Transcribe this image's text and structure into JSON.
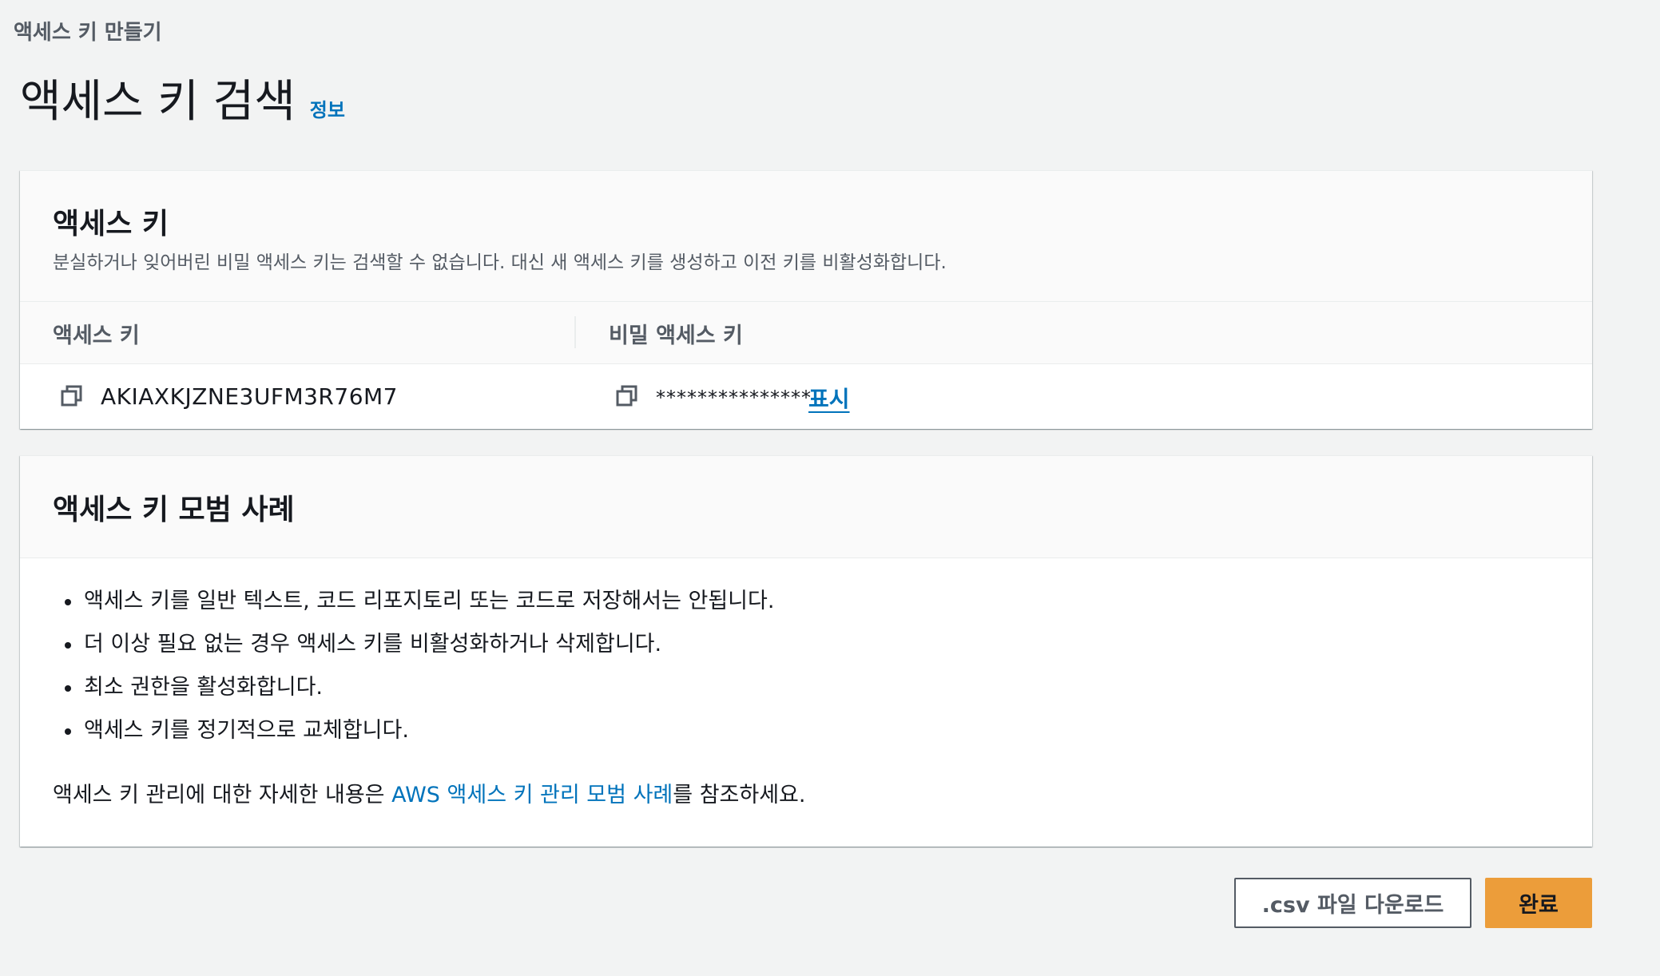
{
  "breadcrumb": {
    "current": "액세스 키 만들기"
  },
  "header": {
    "title": "액세스 키 검색",
    "info_link": "정보"
  },
  "access_keys_panel": {
    "title": "액세스 키",
    "description": "분실하거나 잊어버린 비밀 액세스 키는 검색할 수 없습니다. 대신 새 액세스 키를 생성하고 이전 키를 비활성화합니다.",
    "columns": [
      "액세스 키",
      "비밀 액세스 키"
    ],
    "row": {
      "access_key": "AKIAXKJZNE3UFM3R76M7",
      "secret_masked": "***************",
      "show_label": "표시"
    },
    "copy_icon": "copy-icon"
  },
  "best_practices_panel": {
    "title": "액세스 키 모범 사례",
    "items": [
      "액세스 키를 일반 텍스트, 코드 리포지토리 또는 코드로 저장해서는 안됩니다.",
      "더 이상 필요 없는 경우 액세스 키를 비활성화하거나 삭제합니다.",
      "최소 권한을 활성화합니다.",
      "액세스 키를 정기적으로 교체합니다."
    ],
    "more_info_prefix": "액세스 키 관리에 대한 자세한 내용은 ",
    "more_info_link": "AWS 액세스 키 관리 모범 사례",
    "more_info_suffix": "를 참조하세요."
  },
  "actions": {
    "download_csv": ".csv 파일 다운로드",
    "done": "완료"
  },
  "colors": {
    "background": "#f2f3f3",
    "link": "#0073bb",
    "primary_button": "#ec9d3a",
    "text": "#16191f",
    "secondary_text": "#545b64"
  }
}
